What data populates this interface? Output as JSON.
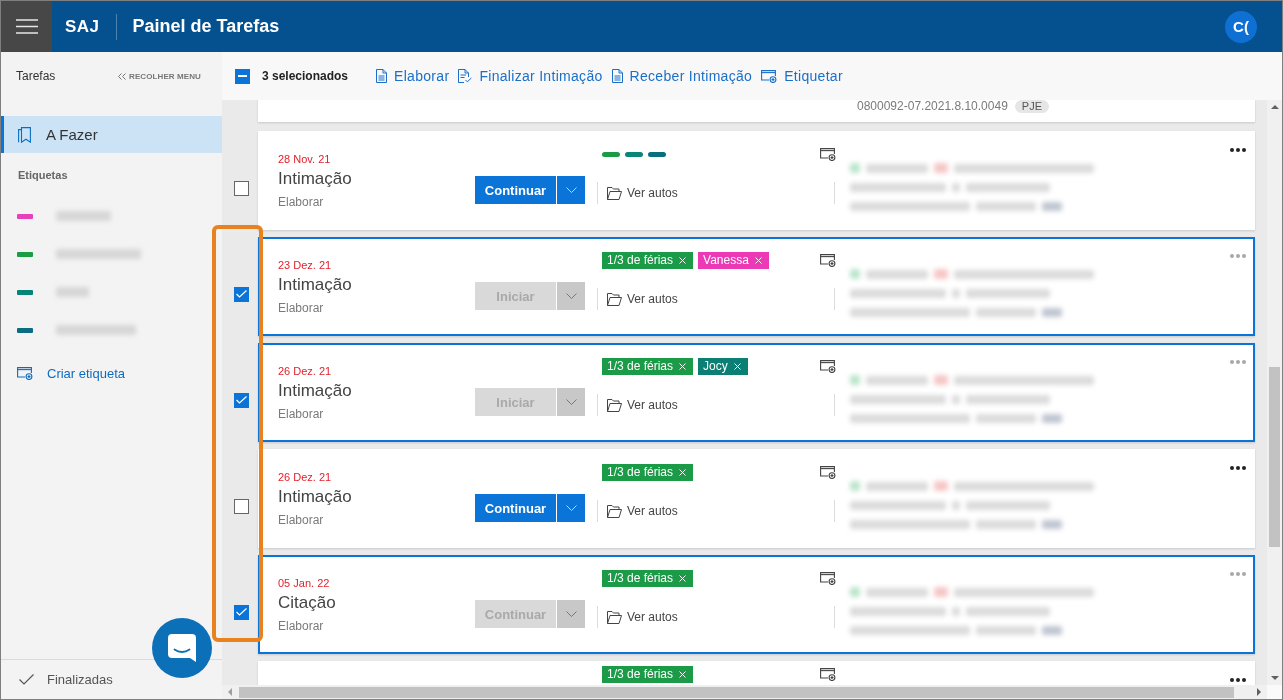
{
  "header": {
    "app_name": "SAJ",
    "title": "Painel de Tarefas",
    "avatar": "C("
  },
  "sidebar": {
    "title": "Tarefas",
    "collapse": "RECOLHER MENU",
    "items": [
      {
        "label": "A Fazer",
        "selected": true
      }
    ],
    "labels_heading": "Etiquetas",
    "labels": [
      {
        "color": "#e83fbd"
      },
      {
        "color": "#1a9e44"
      },
      {
        "color": "#05857a"
      },
      {
        "color": "#0a6d82"
      }
    ],
    "create_label": "Criar etiqueta",
    "footer": "Finalizadas"
  },
  "toolbar": {
    "select_all": {
      "indeterminate": true
    },
    "selection_label": "3 selecionados",
    "actions": [
      "Elaborar",
      "Finalizar Intimação",
      "Receber Intimação",
      "Etiquetar"
    ]
  },
  "partial_above": {
    "process_number": "0800092-07.2021.8.10.0049",
    "badge": "PJE"
  },
  "tasks": [
    {
      "checked": false,
      "date": "28 Nov. 21",
      "title": "Intimação",
      "subtitle": "Elaborar",
      "button": {
        "label": "Continuar",
        "disabled": false
      },
      "tags": [
        {
          "kind": "mark",
          "color": "#1a9c47"
        },
        {
          "kind": "mark",
          "color": "#0b8579"
        },
        {
          "kind": "mark",
          "color": "#0a6e7f"
        }
      ],
      "link": "Ver autos"
    },
    {
      "checked": true,
      "date": "23 Dez. 21",
      "title": "Intimação",
      "subtitle": "Elaborar",
      "button": {
        "label": "Iniciar",
        "disabled": true
      },
      "tags": [
        {
          "kind": "chip",
          "label": "1/3 de férias",
          "color": "#1b9b47"
        },
        {
          "kind": "chip",
          "label": "Vanessa",
          "color": "#ec3ab6"
        }
      ],
      "link": "Ver autos"
    },
    {
      "checked": true,
      "date": "26 Dez. 21",
      "title": "Intimação",
      "subtitle": "Elaborar",
      "button": {
        "label": "Iniciar",
        "disabled": true
      },
      "tags": [
        {
          "kind": "chip",
          "label": "1/3 de férias",
          "color": "#1b9b47"
        },
        {
          "kind": "chip",
          "label": "Jocy",
          "color": "#0b7f73"
        }
      ],
      "link": "Ver autos"
    },
    {
      "checked": false,
      "date": "26 Dez. 21",
      "title": "Intimação",
      "subtitle": "Elaborar",
      "button": {
        "label": "Continuar",
        "disabled": false
      },
      "tags": [
        {
          "kind": "chip",
          "label": "1/3 de férias",
          "color": "#1b9b47"
        }
      ],
      "link": "Ver autos"
    },
    {
      "checked": true,
      "date": "05 Jan. 22",
      "title": "Citação",
      "subtitle": "Elaborar",
      "button": {
        "label": "Continuar",
        "disabled": true
      },
      "tags": [
        {
          "kind": "chip",
          "label": "1/3 de férias",
          "color": "#1b9b47"
        }
      ],
      "link": "Ver autos"
    }
  ],
  "partial_below": {
    "tags": [
      {
        "kind": "chip",
        "label": "1/3 de férias",
        "color": "#1b9b47"
      }
    ]
  }
}
